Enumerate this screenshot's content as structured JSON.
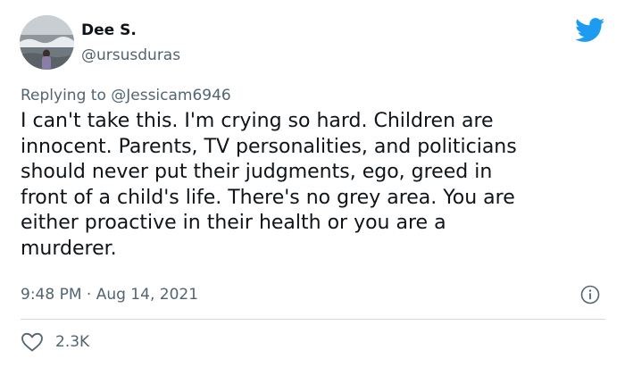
{
  "author": {
    "display_name": "Dee S.",
    "handle": "@ursusduras",
    "avatar_icon": "profile-photo-beach"
  },
  "brand": {
    "icon": "twitter-bird-icon",
    "color": "#1d9bf0"
  },
  "reply": {
    "prefix": "Replying to",
    "mention": "@Jessicam6946"
  },
  "tweet": {
    "text": "I can't take this. I'm crying so hard. Children are\ninnocent. Parents, TV personalities, and politicians\nshould never put their judgments, ego, greed in\nfront of a child's life. There's no grey area. You are\neither proactive in their health or you are a\nmurderer.",
    "timestamp": "9:48 PM · Aug 14, 2021"
  },
  "actions": {
    "info_icon": "info-icon",
    "like_icon": "heart-icon",
    "like_count": "2.3K"
  },
  "colors": {
    "text_primary": "#0f1419",
    "text_secondary": "#536471",
    "divider": "#cfd9de"
  }
}
